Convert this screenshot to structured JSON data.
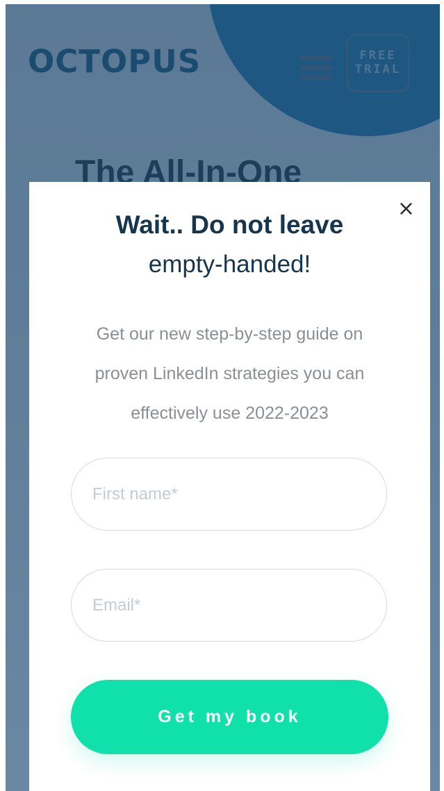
{
  "header": {
    "logo_text": "OCTOPUS",
    "menu_icon": "hamburger-menu-icon",
    "trial_button": {
      "line1": "FREE",
      "line2": "TRIAL"
    }
  },
  "hero": {
    "title": "The All-In-One"
  },
  "popup": {
    "close_icon": "close-icon",
    "close_glyph": "×",
    "title": "Wait.. Do not leave",
    "subtitle": "empty-handed!",
    "description": "Get our new step-by-step guide on proven LinkedIn strategies you can effectively use 2022-2023",
    "first_name_placeholder": "First name*",
    "email_placeholder": "Email*",
    "submit_label": "Get my book"
  },
  "colors": {
    "accent": "#10e0a9",
    "overlay": "#5b7a95",
    "brand_dark": "#1b4b6e",
    "title_text": "#16364d"
  }
}
